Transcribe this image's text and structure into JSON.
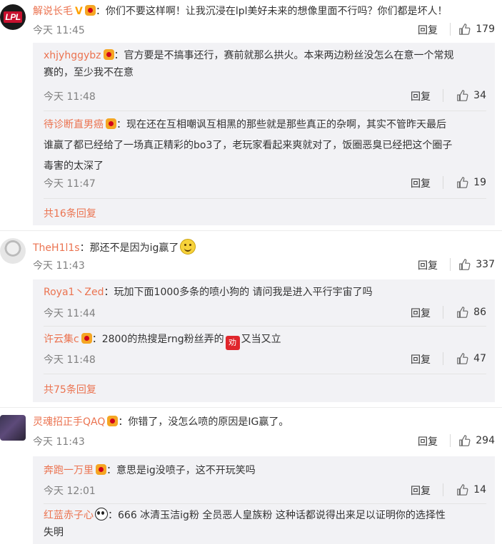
{
  "reply_label": "回复",
  "threads": [
    {
      "user": "解说长毛",
      "verified": "V",
      "text": "：你们不要这样啊！让我沉浸在lpl美好未来的想像里面不行吗？你们都是坏人！",
      "time": "今天 11:45",
      "likes": "179",
      "replies": [
        {
          "user": "xhjyhggybz",
          "text_line1": "：官方要是不搞事还行，赛前就那么拱火。本来两边粉丝没怎么在意一个常规",
          "text_line2": "赛的，至少我不在意",
          "time": "今天 11:48",
          "likes": "34"
        },
        {
          "user": "待诊断直男癌",
          "text_line1": "：现在还在互相嘲讽互相黑的那些就是那些真正的杂啊，其实不管昨天最后",
          "text_line2": "谁赢了都已经给了一场真正精彩的bo3了，老玩家看起来爽就对了，饭圈恶臭已经把这个圈子",
          "text_line3": "毒害的太深了",
          "time": "今天 11:47",
          "likes": "19"
        }
      ],
      "more": "共16条回复"
    },
    {
      "user": "TheH1l1s",
      "text": "：那还不是因为ig赢了",
      "time": "今天 11:43",
      "likes": "337",
      "replies": [
        {
          "user": "Roya1丶Zed",
          "text_line1": "：玩加下面1000多条的喷小狗的 请问我是进入平行宇宙了吗",
          "time": "今天 11:44",
          "likes": "86"
        },
        {
          "user": "许云集c",
          "text_line1a": "：2800的热搜是rng粉丝弄的",
          "stamp": "劝",
          "text_line1b": "又当又立",
          "time": "今天 11:48",
          "likes": "47"
        }
      ],
      "more": "共75条回复"
    },
    {
      "user": "灵魂招正手QAQ",
      "text": "：你错了，没怎么喷的原因是IG赢了。",
      "time": "今天 11:43",
      "likes": "294",
      "replies": [
        {
          "user": "奔跑一万里",
          "text_line1": "：意思是ig没喷子，这不开玩笑吗",
          "time": "今天 12:01",
          "likes": "14"
        },
        {
          "user": "红蓝赤子心",
          "text_line1": "：666  冰清玉洁ig粉  全员恶人皇族粉  这种话都说得出来足以证明你的选择性",
          "text_line2": "失明"
        }
      ]
    }
  ],
  "avatar_1_text": "LPL"
}
